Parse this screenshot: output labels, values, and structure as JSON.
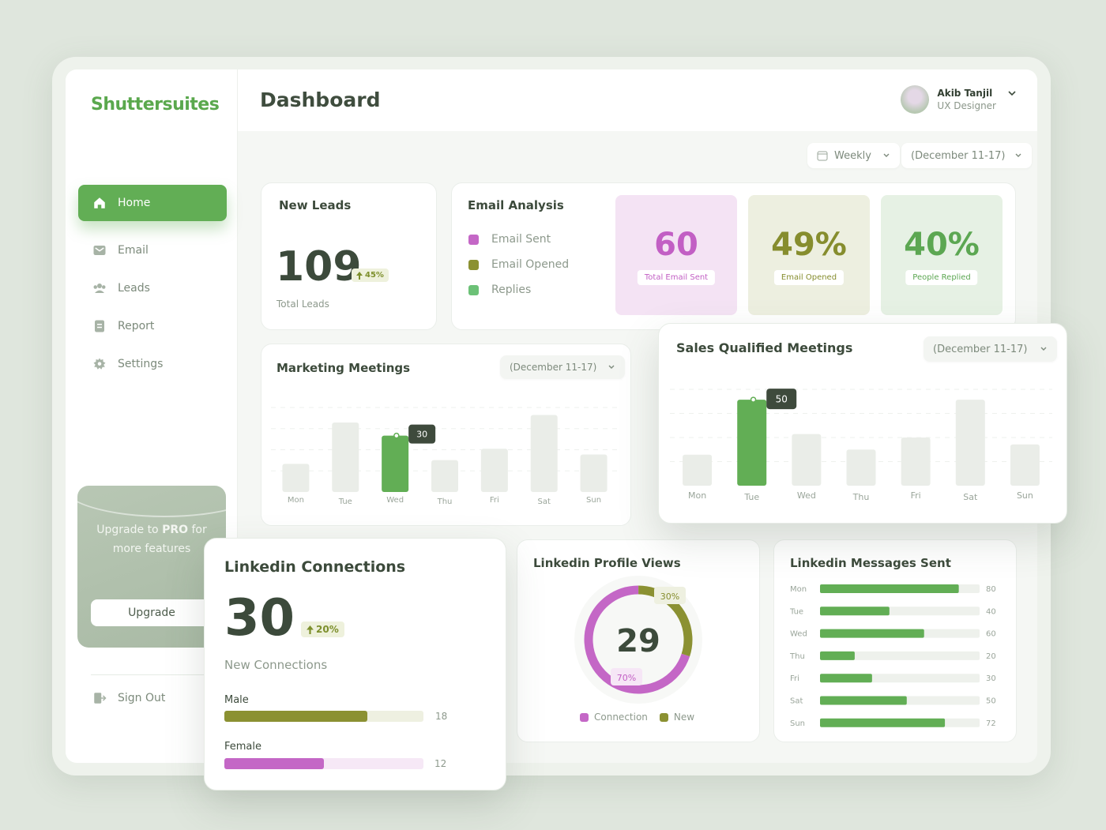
{
  "brand": "Shuttersuites",
  "sidebar": {
    "items": [
      {
        "label": "Home",
        "icon": "home-icon",
        "active": true
      },
      {
        "label": "Email",
        "icon": "mail-icon"
      },
      {
        "label": "Leads",
        "icon": "users-icon"
      },
      {
        "label": "Report",
        "icon": "document-icon"
      },
      {
        "label": "Settings",
        "icon": "gear-icon"
      }
    ],
    "upgrade": {
      "text_pre": "Upgrade to ",
      "text_bold": "PRO",
      "text_post": " for",
      "text_line2": "more features",
      "button": "Upgrade"
    },
    "signout": "Sign Out"
  },
  "header": {
    "title": "Dashboard",
    "user": {
      "name": "Akib Tanjil",
      "role": "UX Designer"
    }
  },
  "filters": {
    "period": "Weekly",
    "range": "(December 11-17)"
  },
  "new_leads": {
    "title": "New Leads",
    "value": "109",
    "change": "45%",
    "caption": "Total Leads"
  },
  "email_analysis": {
    "title": "Email Analysis",
    "legend": [
      {
        "label": "Email Sent",
        "color": "#c467c6"
      },
      {
        "label": "Email Opened",
        "color": "#8b9132"
      },
      {
        "label": "Replies",
        "color": "#6cc177"
      }
    ],
    "stats": [
      {
        "value": "60",
        "label": "Total Email Sent",
        "bg": "#f4e3f4",
        "color": "#c25fc4"
      },
      {
        "value": "49%",
        "label": "Email Opened",
        "bg": "#edefe0",
        "color": "#868d2e"
      },
      {
        "value": "40%",
        "label": "People Replied",
        "bg": "#e6f1e4",
        "color": "#5ca752"
      }
    ]
  },
  "marketing_meetings": {
    "title": "Marketing Meetings",
    "range": "(December 11-17)",
    "chart_data": {
      "type": "bar",
      "categories": [
        "Mon",
        "Tue",
        "Wed",
        "Thu",
        "Fri",
        "Sat",
        "Sun"
      ],
      "values": [
        15,
        37,
        30,
        17,
        23,
        41,
        20
      ],
      "highlight_index": 2,
      "tooltip": "30",
      "ylim": [
        0,
        45
      ]
    }
  },
  "sales_meetings": {
    "title": "Sales Qualified Meetings",
    "range": "(December 11-17)",
    "chart_data": {
      "type": "bar",
      "categories": [
        "Mon",
        "Tue",
        "Wed",
        "Thu",
        "Fri",
        "Sat",
        "Sun"
      ],
      "values": [
        18,
        50,
        30,
        21,
        28,
        50,
        24
      ],
      "highlight_index": 1,
      "tooltip": "50",
      "ylim": [
        0,
        56
      ]
    }
  },
  "linkedin_connections": {
    "title": "Linkedin Connections",
    "value": "30",
    "change": "20%",
    "caption": "New Connections",
    "rows": [
      {
        "label": "Male",
        "value": 18,
        "value_text": "18",
        "max": 25,
        "color": "#8b9132",
        "track": "#eef0e1"
      },
      {
        "label": "Female",
        "value": 12,
        "value_text": "12",
        "max": 24,
        "color": "#c467c6",
        "track": "#f6e8f6"
      }
    ]
  },
  "linkedin_profile_views": {
    "title": "Linkedin Profile Views",
    "center": "29",
    "chart_data": {
      "type": "pie",
      "labels": [
        "Connection",
        "New"
      ],
      "values": [
        70,
        30
      ],
      "value_labels": [
        "70%",
        "30%"
      ],
      "colors": [
        "#c467c6",
        "#8b9132"
      ]
    }
  },
  "linkedin_messages": {
    "title": "Linkedin Messages Sent",
    "chart_data": {
      "type": "bar",
      "orientation": "horizontal",
      "categories": [
        "Mon",
        "Tue",
        "Wed",
        "Thu",
        "Fri",
        "Sat",
        "Sun"
      ],
      "values": [
        80,
        40,
        60,
        20,
        30,
        50,
        72
      ],
      "value_labels": [
        "80",
        "40",
        "60",
        "20",
        "30",
        "50",
        "72"
      ],
      "xlim": [
        0,
        92
      ]
    }
  }
}
